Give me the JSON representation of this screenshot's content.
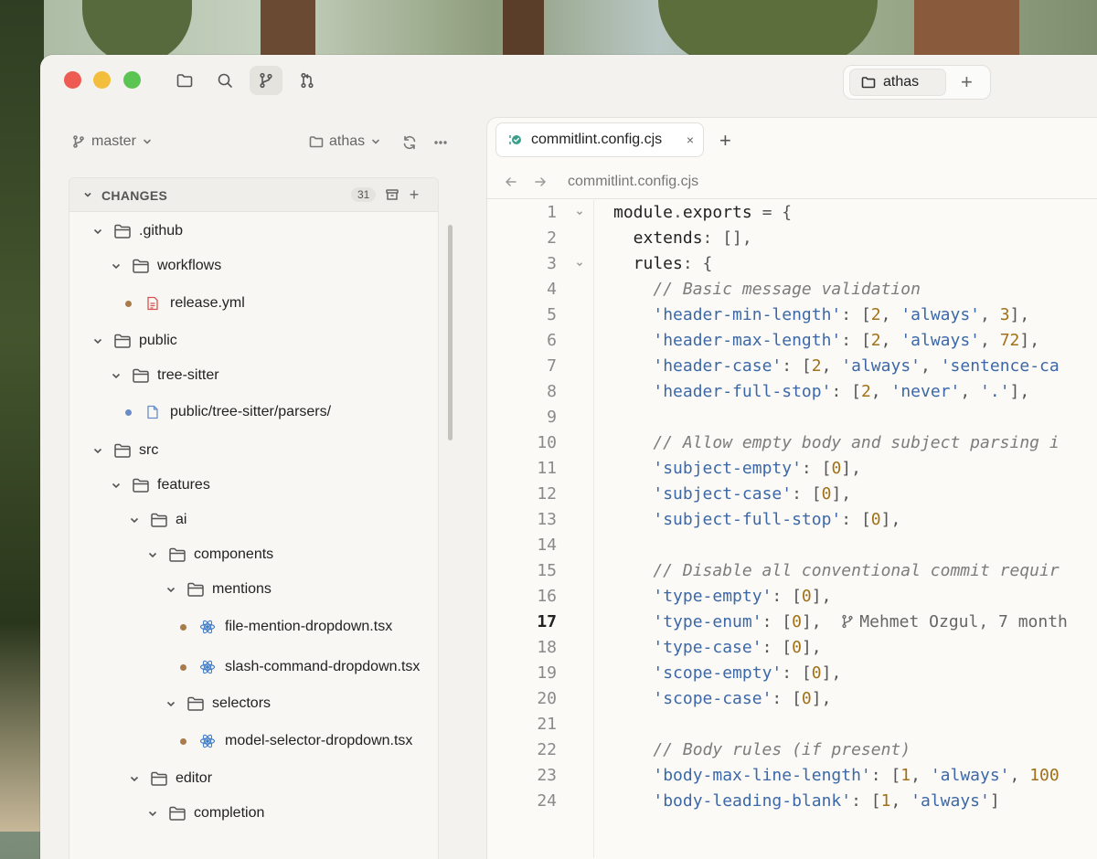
{
  "titlebar": {
    "project_tab_label": "athas",
    "add_project_label": "+"
  },
  "sidebar": {
    "branch_label": "master",
    "repo_label": "athas",
    "changes": {
      "title": "CHANGES",
      "count": "31",
      "add_label": "+"
    },
    "tree": [
      {
        "label": ".github",
        "kind": "folder",
        "depth": 0
      },
      {
        "label": "workflows",
        "kind": "folder",
        "depth": 1
      },
      {
        "label": "release.yml",
        "kind": "file",
        "depth": 2,
        "icon": "yaml-file-icon",
        "dot": "#a87b4a"
      },
      {
        "label": "public",
        "kind": "folder",
        "depth": 0
      },
      {
        "label": "tree-sitter",
        "kind": "folder",
        "depth": 1
      },
      {
        "label": "public/tree-sitter/parsers/",
        "kind": "file",
        "depth": 2,
        "icon": "document-file-icon",
        "dot": "#6a8cc7"
      },
      {
        "label": "src",
        "kind": "folder",
        "depth": 0
      },
      {
        "label": "features",
        "kind": "folder",
        "depth": 1
      },
      {
        "label": "ai",
        "kind": "folder",
        "depth": 2
      },
      {
        "label": "components",
        "kind": "folder",
        "depth": 3
      },
      {
        "label": "mentions",
        "kind": "folder",
        "depth": 4
      },
      {
        "label": "file-mention-dropdown.tsx",
        "kind": "file",
        "depth": 5,
        "icon": "react-file-icon",
        "dot": "#a87b4a"
      },
      {
        "label": "slash-command-dropdown.tsx",
        "kind": "file",
        "depth": 5,
        "icon": "react-file-icon",
        "dot": "#a87b4a"
      },
      {
        "label": "selectors",
        "kind": "folder",
        "depth": 4
      },
      {
        "label": "model-selector-dropdown.tsx",
        "kind": "file",
        "depth": 5,
        "icon": "react-file-icon",
        "dot": "#a87b4a"
      },
      {
        "label": "editor",
        "kind": "folder",
        "depth": 2
      },
      {
        "label": "completion",
        "kind": "folder",
        "depth": 3
      }
    ]
  },
  "editor": {
    "tab_label": "commitlint.config.cjs",
    "tab_close": "×",
    "tab_add": "+",
    "breadcrumb": "commitlint.config.cjs",
    "current_line": 17,
    "blame": "Mehmet Ozgul, 7 month",
    "lines": [
      {
        "n": "1",
        "fold": true,
        "tokens": [
          [
            "t",
            "module"
          ],
          [
            "p",
            "."
          ],
          [
            "t",
            "exports"
          ],
          [
            "p",
            " = {"
          ]
        ]
      },
      {
        "n": "2",
        "tokens": [
          [
            "t",
            "  extends"
          ],
          [
            "p",
            ": [],"
          ]
        ]
      },
      {
        "n": "3",
        "fold": true,
        "tokens": [
          [
            "t",
            "  rules"
          ],
          [
            "p",
            ": {"
          ]
        ]
      },
      {
        "n": "4",
        "tokens": [
          [
            "c",
            "    // Basic message validation"
          ]
        ]
      },
      {
        "n": "5",
        "tokens": [
          [
            "t",
            "    "
          ],
          [
            "s",
            "'header-min-length'"
          ],
          [
            "p",
            ": ["
          ],
          [
            "n",
            "2"
          ],
          [
            "p",
            ", "
          ],
          [
            "s",
            "'always'"
          ],
          [
            "p",
            ", "
          ],
          [
            "n",
            "3"
          ],
          [
            "p",
            "],"
          ]
        ]
      },
      {
        "n": "6",
        "tokens": [
          [
            "t",
            "    "
          ],
          [
            "s",
            "'header-max-length'"
          ],
          [
            "p",
            ": ["
          ],
          [
            "n",
            "2"
          ],
          [
            "p",
            ", "
          ],
          [
            "s",
            "'always'"
          ],
          [
            "p",
            ", "
          ],
          [
            "n",
            "72"
          ],
          [
            "p",
            "],"
          ]
        ]
      },
      {
        "n": "7",
        "tokens": [
          [
            "t",
            "    "
          ],
          [
            "s",
            "'header-case'"
          ],
          [
            "p",
            ": ["
          ],
          [
            "n",
            "2"
          ],
          [
            "p",
            ", "
          ],
          [
            "s",
            "'always'"
          ],
          [
            "p",
            ", "
          ],
          [
            "s",
            "'sentence-ca"
          ]
        ]
      },
      {
        "n": "8",
        "tokens": [
          [
            "t",
            "    "
          ],
          [
            "s",
            "'header-full-stop'"
          ],
          [
            "p",
            ": ["
          ],
          [
            "n",
            "2"
          ],
          [
            "p",
            ", "
          ],
          [
            "s",
            "'never'"
          ],
          [
            "p",
            ", "
          ],
          [
            "s",
            "'.'"
          ],
          [
            "p",
            "],"
          ]
        ]
      },
      {
        "n": "9",
        "tokens": []
      },
      {
        "n": "10",
        "tokens": [
          [
            "c",
            "    // Allow empty body and subject parsing i"
          ]
        ]
      },
      {
        "n": "11",
        "tokens": [
          [
            "t",
            "    "
          ],
          [
            "s",
            "'subject-empty'"
          ],
          [
            "p",
            ": ["
          ],
          [
            "n",
            "0"
          ],
          [
            "p",
            "],"
          ]
        ]
      },
      {
        "n": "12",
        "tokens": [
          [
            "t",
            "    "
          ],
          [
            "s",
            "'subject-case'"
          ],
          [
            "p",
            ": ["
          ],
          [
            "n",
            "0"
          ],
          [
            "p",
            "],"
          ]
        ]
      },
      {
        "n": "13",
        "tokens": [
          [
            "t",
            "    "
          ],
          [
            "s",
            "'subject-full-stop'"
          ],
          [
            "p",
            ": ["
          ],
          [
            "n",
            "0"
          ],
          [
            "p",
            "],"
          ]
        ]
      },
      {
        "n": "14",
        "tokens": []
      },
      {
        "n": "15",
        "tokens": [
          [
            "c",
            "    // Disable all conventional commit requir"
          ]
        ]
      },
      {
        "n": "16",
        "tokens": [
          [
            "t",
            "    "
          ],
          [
            "s",
            "'type-empty'"
          ],
          [
            "p",
            ": ["
          ],
          [
            "n",
            "0"
          ],
          [
            "p",
            "],"
          ]
        ]
      },
      {
        "n": "17",
        "blame": true,
        "tokens": [
          [
            "t",
            "    "
          ],
          [
            "s",
            "'type-enum'"
          ],
          [
            "p",
            ": ["
          ],
          [
            "n",
            "0"
          ],
          [
            "p",
            "],  "
          ]
        ]
      },
      {
        "n": "18",
        "tokens": [
          [
            "t",
            "    "
          ],
          [
            "s",
            "'type-case'"
          ],
          [
            "p",
            ": ["
          ],
          [
            "n",
            "0"
          ],
          [
            "p",
            "],"
          ]
        ]
      },
      {
        "n": "19",
        "tokens": [
          [
            "t",
            "    "
          ],
          [
            "s",
            "'scope-empty'"
          ],
          [
            "p",
            ": ["
          ],
          [
            "n",
            "0"
          ],
          [
            "p",
            "],"
          ]
        ]
      },
      {
        "n": "20",
        "tokens": [
          [
            "t",
            "    "
          ],
          [
            "s",
            "'scope-case'"
          ],
          [
            "p",
            ": ["
          ],
          [
            "n",
            "0"
          ],
          [
            "p",
            "],"
          ]
        ]
      },
      {
        "n": "21",
        "tokens": []
      },
      {
        "n": "22",
        "tokens": [
          [
            "c",
            "    // Body rules (if present)"
          ]
        ]
      },
      {
        "n": "23",
        "tokens": [
          [
            "t",
            "    "
          ],
          [
            "s",
            "'body-max-line-length'"
          ],
          [
            "p",
            ": ["
          ],
          [
            "n",
            "1"
          ],
          [
            "p",
            ", "
          ],
          [
            "s",
            "'always'"
          ],
          [
            "p",
            ", "
          ],
          [
            "n",
            "100"
          ]
        ]
      },
      {
        "n": "24",
        "tokens": [
          [
            "t",
            "    "
          ],
          [
            "s",
            "'body-leading-blank'"
          ],
          [
            "p",
            ": ["
          ],
          [
            "n",
            "1"
          ],
          [
            "p",
            ", "
          ],
          [
            "s",
            "'always'"
          ],
          [
            "p",
            "]"
          ]
        ]
      }
    ]
  },
  "colors": {
    "close": "#ee5b52",
    "minimize": "#f3be3b",
    "zoom": "#5cc453",
    "string": "#3c68a8",
    "number": "#a07118",
    "comment": "#7c7c7c"
  }
}
